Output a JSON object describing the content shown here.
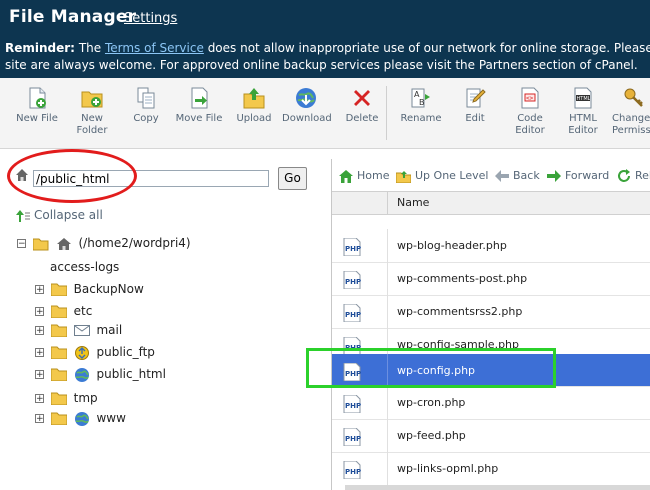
{
  "header": {
    "title": "File Manager",
    "settings": "Settings",
    "reminder_label": "Reminder:",
    "reminder_pre": "The",
    "tos_link": "Terms of Service",
    "reminder_line1_rest": "does not allow inappropriate use of our network for online storage. Please see",
    "reminder_line2": "site are always welcome. For approved online backup services please visit the Partners section of cPanel."
  },
  "toolbar": {
    "buttons": [
      {
        "label": "New File",
        "icon": "new-file-icon"
      },
      {
        "label": "New Folder",
        "icon": "new-folder-icon"
      },
      {
        "label": "Copy",
        "icon": "copy-icon"
      },
      {
        "label": "Move File",
        "icon": "move-file-icon"
      },
      {
        "label": "Upload",
        "icon": "upload-icon"
      },
      {
        "label": "Download",
        "icon": "download-icon"
      },
      {
        "label": "Delete",
        "icon": "delete-icon"
      },
      {
        "label": "Rename",
        "icon": "rename-icon"
      },
      {
        "label": "Edit",
        "icon": "edit-icon"
      },
      {
        "label": "Code Editor",
        "icon": "code-editor-icon"
      },
      {
        "label": "HTML Editor",
        "icon": "html-editor-icon"
      },
      {
        "label": "Change Permissions",
        "icon": "permissions-icon"
      }
    ]
  },
  "left": {
    "path_value": "/public_html",
    "go": "Go",
    "collapse_all": "Collapse all",
    "tree": {
      "root": "(/home2/wordpri4)",
      "items": [
        "access-logs",
        "BackupNow",
        "etc",
        "mail",
        "public_ftp",
        "public_html",
        "tmp",
        "www"
      ]
    }
  },
  "right": {
    "nav": {
      "home": "Home",
      "up_one_level": "Up One Level",
      "back": "Back",
      "forward": "Forward",
      "reload": "Reload"
    },
    "column_name": "Name",
    "files": [
      {
        "name": "wp-blog-header.php"
      },
      {
        "name": "wp-comments-post.php"
      },
      {
        "name": "wp-commentsrss2.php"
      },
      {
        "name": "wp-config-sample.php"
      },
      {
        "name": "wp-config.php",
        "selected": true
      },
      {
        "name": "wp-cron.php"
      },
      {
        "name": "wp-feed.php"
      },
      {
        "name": "wp-links-opml.php"
      }
    ]
  },
  "colors": {
    "header_bg": "#0d3550",
    "link": "#8cc6f5",
    "selected_row": "#3d6fd6",
    "highlight_red": "#e21c1c",
    "highlight_green": "#2bd12b"
  }
}
